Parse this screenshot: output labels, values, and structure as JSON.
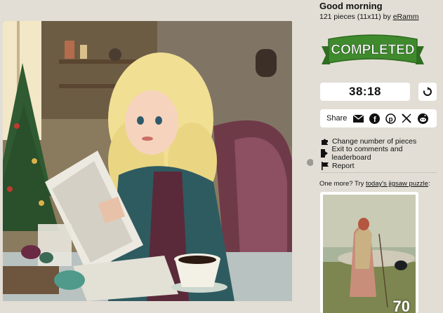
{
  "puzzle": {
    "title": "Good morning",
    "pieces_text": "121 pieces (11x11) by",
    "author": "eRamm"
  },
  "badge": {
    "text": "COMPLETED",
    "color": "#3f8a2d"
  },
  "timer": {
    "value": "38:18"
  },
  "share": {
    "label": "Share",
    "icons": [
      "email-icon",
      "facebook-icon",
      "pinterest-icon",
      "x-icon",
      "reddit-icon"
    ]
  },
  "menu": {
    "items": [
      {
        "label": "Change number of pieces",
        "icon": "puzzle-piece-icon"
      },
      {
        "label": "Exit to comments and leaderboard",
        "icon": "exit-icon"
      },
      {
        "label": "Report",
        "icon": "flag-icon"
      }
    ]
  },
  "suggestion": {
    "prefix": "One more? Try",
    "link": "today's jigsaw puzzle",
    "suffix": ":",
    "thumb_count": "70"
  }
}
